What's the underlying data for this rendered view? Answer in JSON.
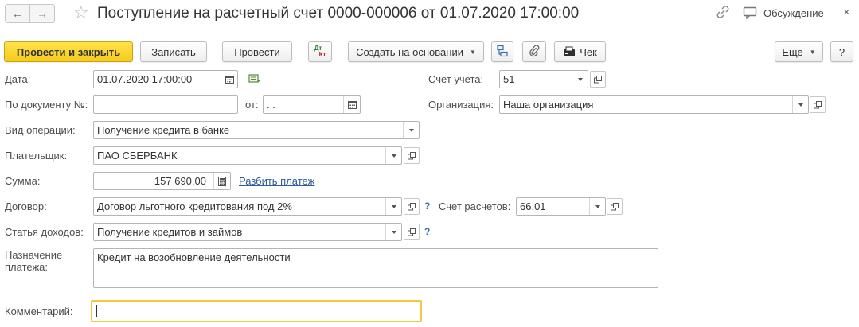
{
  "window": {
    "title": "Поступление на расчетный счет 0000-000006 от 01.07.2020 17:00:00",
    "discussion_label": "Обсуждение",
    "close_glyph": "×",
    "back_glyph": "←",
    "forward_glyph": "→",
    "favorite_glyph": "☆"
  },
  "toolbar": {
    "post_and_close": "Провести и закрыть",
    "save": "Записать",
    "post": "Провести",
    "dt_label": "Дт",
    "kt_label": "Кт",
    "create_based_on": "Создать на основании",
    "check": "Чек",
    "more": "Еще",
    "help": "?"
  },
  "form": {
    "date": {
      "label": "Дата:",
      "value": "01.07.2020 17:00:00"
    },
    "doc_number": {
      "label": "По документу №:",
      "value": ""
    },
    "doc_date": {
      "label": "от:",
      "value": " .  ."
    },
    "operation_type": {
      "label": "Вид операции:",
      "value": "Получение кредита в банке"
    },
    "payer": {
      "label": "Плательщик:",
      "value": "ПАО СБЕРБАНК"
    },
    "amount": {
      "label": "Сумма:",
      "value": "157 690,00"
    },
    "split_payment": "Разбить платеж",
    "contract": {
      "label": "Договор:",
      "value": "Договор льготного кредитования под 2%"
    },
    "settlement_account": {
      "label": "Счет расчетов:",
      "value": "66.01"
    },
    "income_item": {
      "label": "Статья доходов:",
      "value": "Получение кредитов и займов"
    },
    "payment_purpose": {
      "label_line1": "Назначение",
      "label_line2": "платежа:",
      "value": "Кредит на возобновление деятельности"
    },
    "comment": {
      "label": "Комментарий:",
      "value": ""
    },
    "account": {
      "label": "Счет учета:",
      "value": "51"
    },
    "organization": {
      "label": "Организация:",
      "value": "Наша организация"
    },
    "help_mark": "?"
  },
  "colors": {
    "primary_button": "#f6cb1b",
    "link": "#2d5c99",
    "focus_border": "#f2c744"
  }
}
